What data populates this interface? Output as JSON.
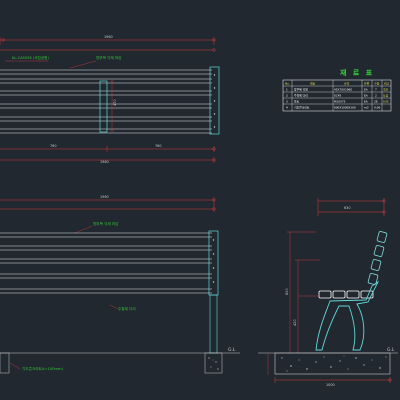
{
  "colors": {
    "background": "#212830",
    "dimension_line": "#d23a3a",
    "outline": "#ffffff",
    "wood": "#7fd8d8",
    "cyan": "#5fd7d7",
    "note_text": "#35c935",
    "ground": "#c9c9c9"
  },
  "top_view": {
    "dim_total_top": "1960",
    "label_material": "KL-CAS058 (국립공원)",
    "label_timber": "방부목 각재 마감",
    "dim_height": "470",
    "dim_left": "760",
    "dim_right": "760",
    "dim_total_bottom": "1960"
  },
  "front_view": {
    "dim_total_top": "1960",
    "label_timber": "방부목 각재 마감",
    "label_frame": "주철제 다리",
    "label_foundation": "기초콘크리트(t=100mm)",
    "ground_label": "G.L"
  },
  "side_view": {
    "dim_top": "630",
    "dim_height": "800",
    "dim_seat_height": "420",
    "dim_bottom": "1000",
    "ground_label": "G.L"
  },
  "material_table": {
    "title": "재 료 표",
    "headers": [
      "No.",
      "재료",
      "규격",
      "단위",
      "수량",
      "비고"
    ],
    "rows": [
      [
        "1",
        "방부목 각재",
        "45X70X1960",
        "EA",
        "7",
        "국산"
      ],
      [
        "2",
        "주철제 다리",
        "SC45",
        "EA",
        "2",
        "도장"
      ],
      [
        "3",
        "볼트",
        "M10X75",
        "EA",
        "28",
        "SUS"
      ],
      [
        "4",
        "기초콘크리트",
        "600X1000X100",
        "m3",
        "0.06",
        ""
      ]
    ]
  }
}
